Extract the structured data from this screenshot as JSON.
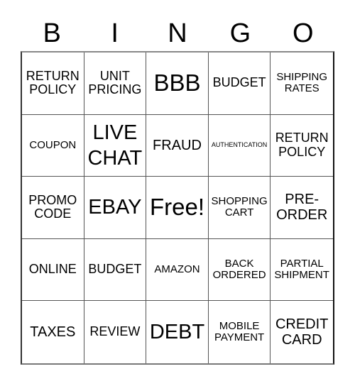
{
  "header": {
    "letters": [
      "B",
      "I",
      "N",
      "G",
      "O"
    ]
  },
  "cells": [
    {
      "text": "RETURN POLICY",
      "size": "m"
    },
    {
      "text": "UNIT PRICING",
      "size": "m"
    },
    {
      "text": "BBB",
      "size": "xxl"
    },
    {
      "text": "BUDGET",
      "size": "m"
    },
    {
      "text": "SHIPPING RATES",
      "size": "s"
    },
    {
      "text": "COUPON",
      "size": "s"
    },
    {
      "text": "LIVE CHAT",
      "size": "xl"
    },
    {
      "text": "FRAUD",
      "size": "l"
    },
    {
      "text": "AUTHENTICATION",
      "size": "xs"
    },
    {
      "text": "RETURN POLICY",
      "size": "m"
    },
    {
      "text": "PROMO CODE",
      "size": "m"
    },
    {
      "text": "EBAY",
      "size": "xl"
    },
    {
      "text": "Free!",
      "size": "xxl"
    },
    {
      "text": "SHOPPING CART",
      "size": "s"
    },
    {
      "text": "PRE-ORDER",
      "size": "l"
    },
    {
      "text": "ONLINE",
      "size": "m"
    },
    {
      "text": "BUDGET",
      "size": "m"
    },
    {
      "text": "AMAZON",
      "size": "s"
    },
    {
      "text": "BACK ORDERED",
      "size": "s"
    },
    {
      "text": "PARTIAL SHIPMENT",
      "size": "s"
    },
    {
      "text": "TAXES",
      "size": "l"
    },
    {
      "text": "REVIEW",
      "size": "m"
    },
    {
      "text": "DEBT",
      "size": "xl"
    },
    {
      "text": "MOBILE PAYMENT",
      "size": "s"
    },
    {
      "text": "CREDIT CARD",
      "size": "l"
    }
  ]
}
